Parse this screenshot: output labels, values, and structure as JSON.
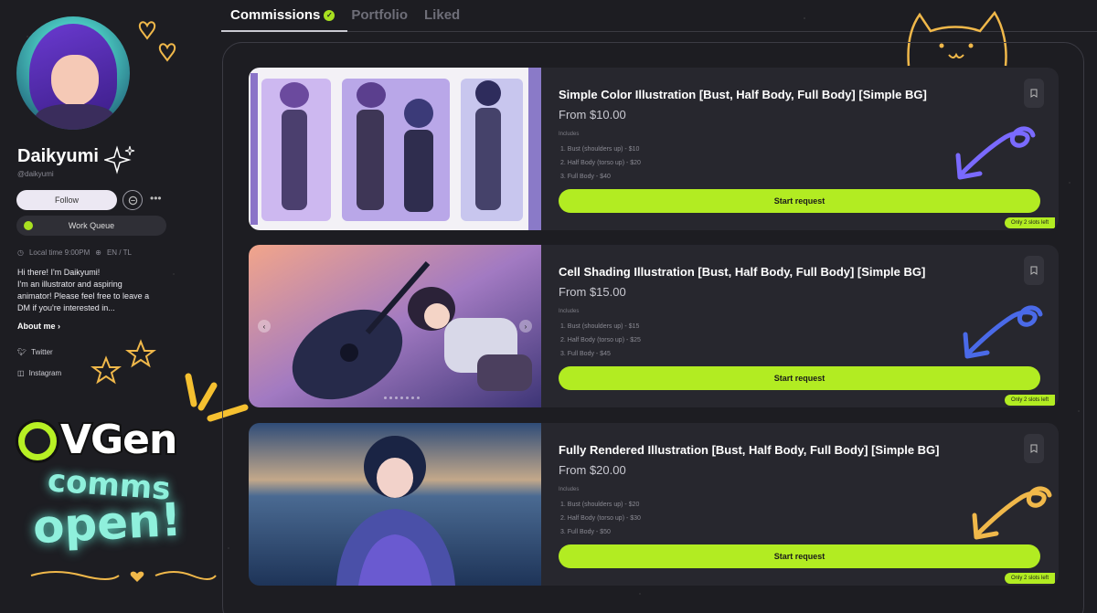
{
  "profile": {
    "name": "Daikyumi",
    "handle": "@daikyumi",
    "follow_label": "Follow",
    "more_label": "•••",
    "work_queue_label": "Work Queue",
    "local_time": "Local time 9:00PM",
    "languages": "EN / TL",
    "bio": "Hi there! I'm Daikyumi!\nI'm an illustrator and aspiring\nanimator! Please feel free to leave a\nDM if you're interested in...",
    "about_label": "About me ›",
    "socials": [
      {
        "label": "Twitter",
        "icon": "twitter-icon"
      },
      {
        "label": "Instagram",
        "icon": "instagram-icon"
      }
    ]
  },
  "branding": {
    "logo_text": "VGen",
    "comms_text": "comms",
    "open_text": "open!"
  },
  "tabs": [
    {
      "label": "Commissions",
      "active": true
    },
    {
      "label": "Portfolio",
      "active": false
    },
    {
      "label": "Liked",
      "active": false
    }
  ],
  "commissions": [
    {
      "title": "Simple Color Illustration [Bust, Half Body, Full Body] [Simple BG]",
      "price": "From $10.00",
      "includes_label": "Includes",
      "items": [
        "1. Bust (shoulders up) - $10",
        "2. Half Body (torso up) - $20",
        "3. Full Body - $40"
      ],
      "button_label": "Start request",
      "slots_label": "Only 2 slots left"
    },
    {
      "title": "Cell Shading Illustration [Bust, Half Body, Full Body] [Simple BG]",
      "price": "From $15.00",
      "includes_label": "Includes",
      "items": [
        "1. Bust (shoulders up) - $15",
        "2. Half Body (torso up) - $25",
        "3. Full Body - $45"
      ],
      "button_label": "Start request",
      "slots_label": "Only 2 slots left"
    },
    {
      "title": "Fully Rendered Illustration [Bust, Half Body, Full Body] [Simple BG]",
      "price": "From $20.00",
      "includes_label": "Includes",
      "items": [
        "1. Bust (shoulders up) - $20",
        "2. Half Body (torso up) - $30",
        "3. Full Body - $50"
      ],
      "button_label": "Start request",
      "slots_label": "Only 2 slots left"
    }
  ],
  "colors": {
    "background": "#1d1d22",
    "accent": "#b2ec22",
    "card": "#27272e",
    "glow_text": "#8ff0dc"
  }
}
